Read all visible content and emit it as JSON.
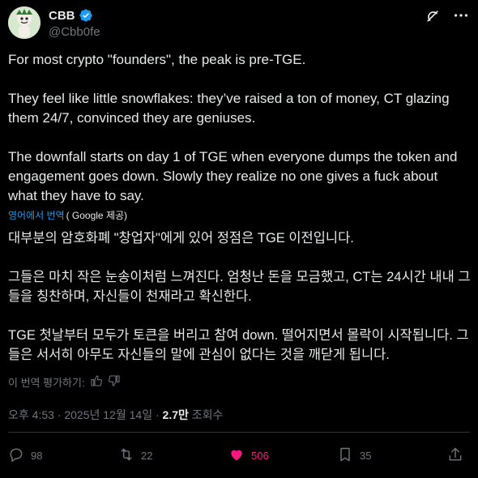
{
  "author": {
    "name": "CBB",
    "handle": "@Cbb0fe",
    "verified_color": "#1d9bf0"
  },
  "icons": {
    "grok": "grok-icon",
    "more": "more-icon"
  },
  "tweet": {
    "paragraphs": [
      "For most crypto \"founders\", the peak is pre-TGE.",
      "They feel like little snowflakes: they’ve raised a ton of money, CT glazing them 24/7, convinced they are geniuses.",
      "The downfall starts on day 1 of TGE when everyone dumps the token and engagement goes down. Slowly they realize no one gives a fuck about what they have to say."
    ]
  },
  "translation": {
    "link_label": "영어에서 번역",
    "by_label": "( Google 제공)",
    "paragraphs": [
      "대부분의 암호화폐 \"창업자\"에게 있어 정점은 TGE 이전입니다.",
      "그들은 마치 작은 눈송이처럼 느껴진다. 엄청난 돈을 모금했고, CT는 24시간 내내 그들을 칭찬하며, 자신들이 천재라고 확신한다.",
      "TGE 첫날부터 모두가 토큰을 버리고 참여 down. 떨어지면서 몰락이 시작됩니다. 그들은 서서히 아무도 자신들의 말에 관심이 없다는 것을 깨닫게 됩니다."
    ],
    "rate_label": "이 번역 평가하기:"
  },
  "meta": {
    "time": "오후 4:53",
    "separator": "·",
    "date": "2025년 12월 14일",
    "views_count": "2.7만",
    "views_label": "조회수"
  },
  "actions": {
    "replies": "98",
    "retweets": "22",
    "likes": "506",
    "bookmarks": "35",
    "like_color": "#f91880"
  }
}
